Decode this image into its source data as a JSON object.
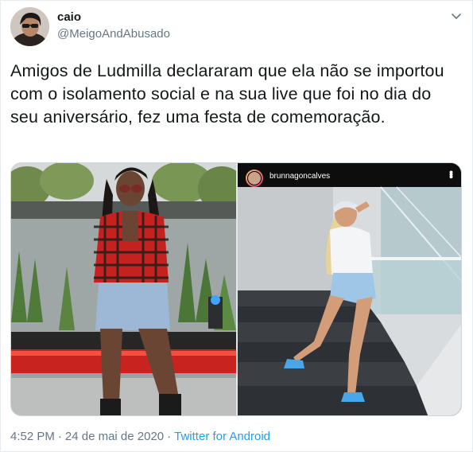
{
  "user": {
    "name": "caio",
    "handle": "@MeigoAndAbusado"
  },
  "tweet": {
    "text": "Amigos de Ludmilla declararam que ela não se importou com o isolamento social e na sua live que foi no dia do seu aniversário, fez uma festa de comemoração."
  },
  "media": {
    "right_photo": {
      "instagram_username": "brunnagoncalves"
    }
  },
  "meta": {
    "time": "4:52 PM",
    "separator": "·",
    "date": "24 de mai de 2020",
    "source": "Twitter for Android"
  },
  "icons": {
    "chevron": "chevron-down-icon",
    "more": "more-vertical-icon"
  },
  "colors": {
    "link": "#1da1f2",
    "secondary_text": "#657786",
    "primary_text": "#14171a"
  }
}
